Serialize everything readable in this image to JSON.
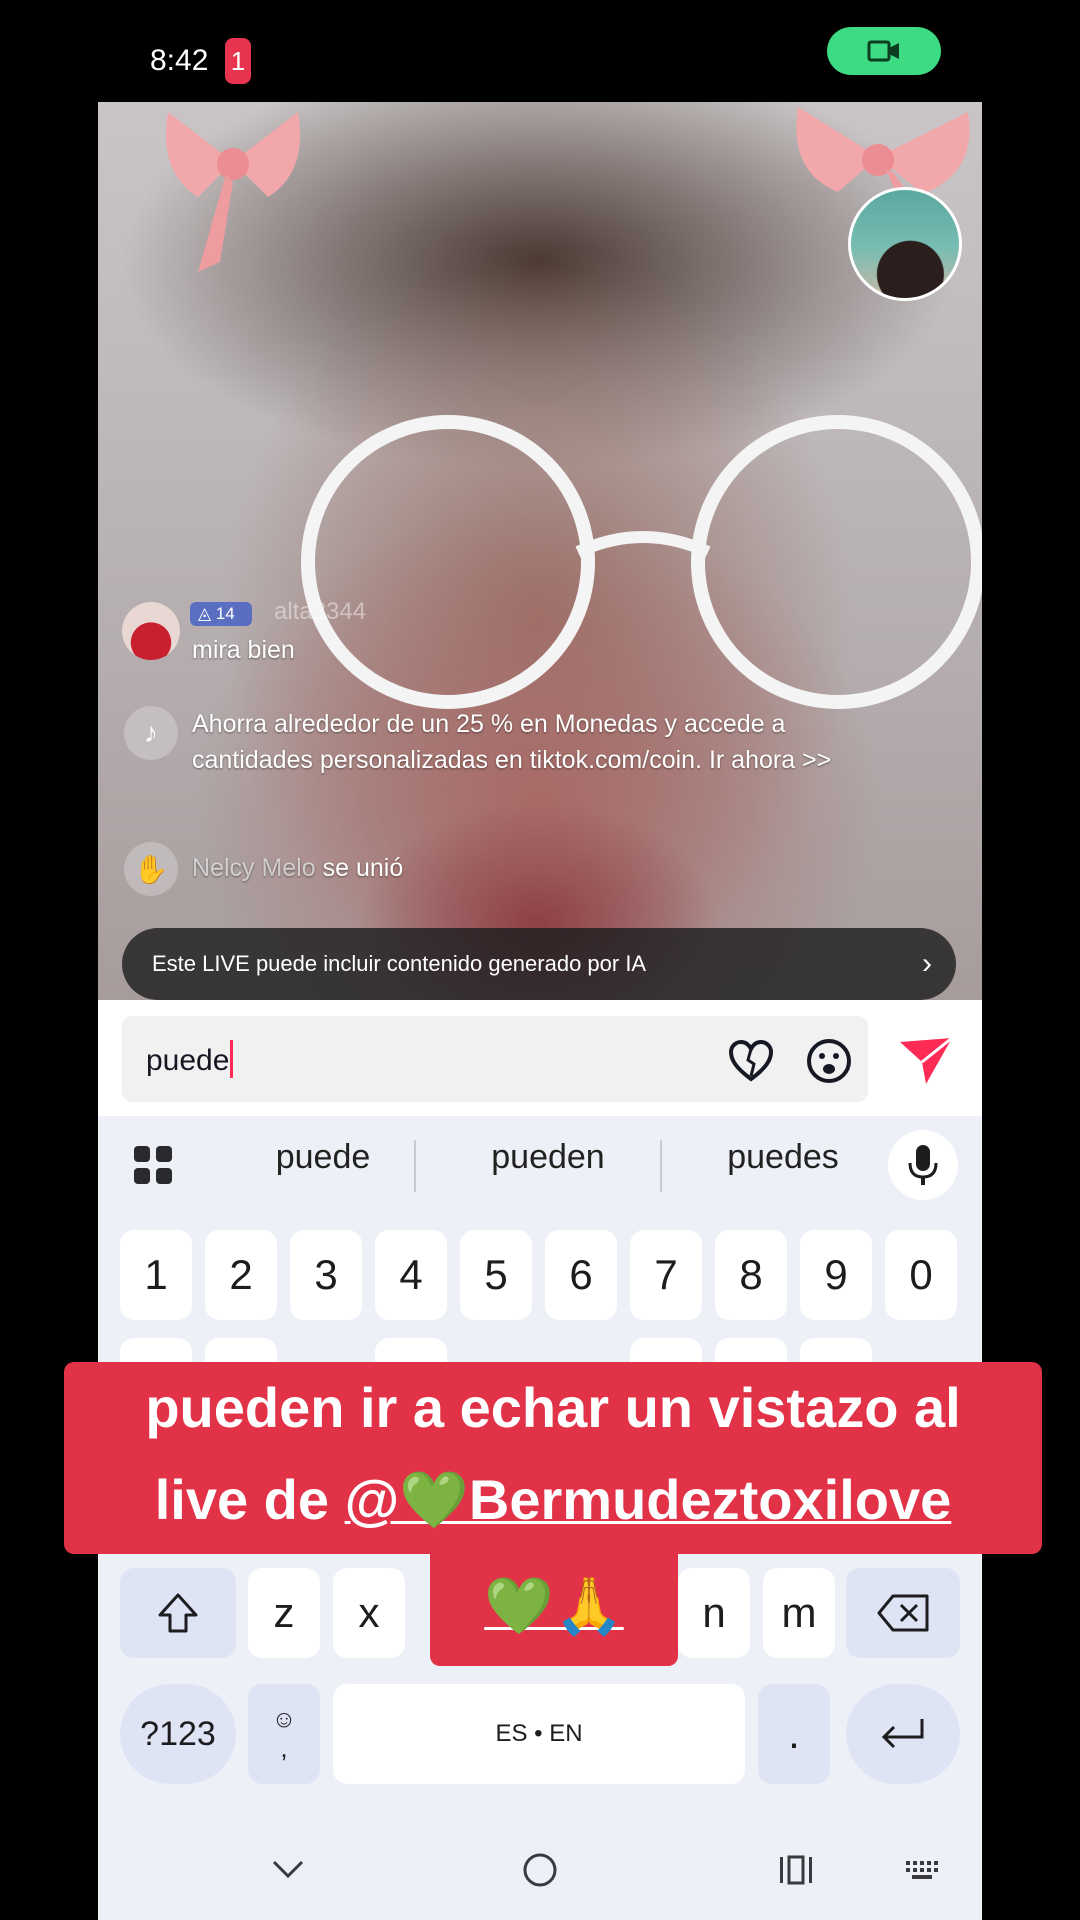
{
  "status": {
    "time": "8:42",
    "notification_count": "1",
    "pill_color": "#3ddc84"
  },
  "live": {
    "comment": {
      "level": "14",
      "username_faded": "alta2344",
      "text": "mira bien"
    },
    "system_message": "Ahorra alrededor de un 25 % en Monedas y accede a cantidades personalizadas en tiktok.com/coin. Ir ahora >>",
    "join_event": {
      "name": "Nelcy Melo",
      "action": "se unió"
    },
    "ai_banner": "Este LIVE puede incluir contenido generado por IA"
  },
  "comment_input": {
    "value": "puede",
    "send_color": "#fe2c55"
  },
  "keyboard": {
    "suggestions": [
      "puede",
      "pueden",
      "puedes"
    ],
    "number_row": [
      "1",
      "2",
      "3",
      "4",
      "5",
      "6",
      "7",
      "8",
      "9",
      "0"
    ],
    "bottom_letters": [
      "z",
      "x",
      "n",
      "m"
    ],
    "symbols_key": "?123",
    "comma_key": ",",
    "space_label": "ES • EN",
    "period_key": "."
  },
  "caption": {
    "line1": "pueden ir a echar un vistazo al",
    "line2_prefix": "live de ",
    "line2_mention": "@💚Bermudeztoxilove",
    "line3": "💚🙏",
    "color": "#e13248"
  },
  "icons": [
    "video-camera-icon",
    "tiktok-icon",
    "wave-icon",
    "heart-icon",
    "emoji-icon",
    "send-icon",
    "apps-grid-icon",
    "mic-icon",
    "shift-icon",
    "backspace-icon",
    "enter-icon",
    "nav-back-icon",
    "nav-home-icon",
    "nav-recents-icon",
    "nav-keyboard-icon"
  ]
}
